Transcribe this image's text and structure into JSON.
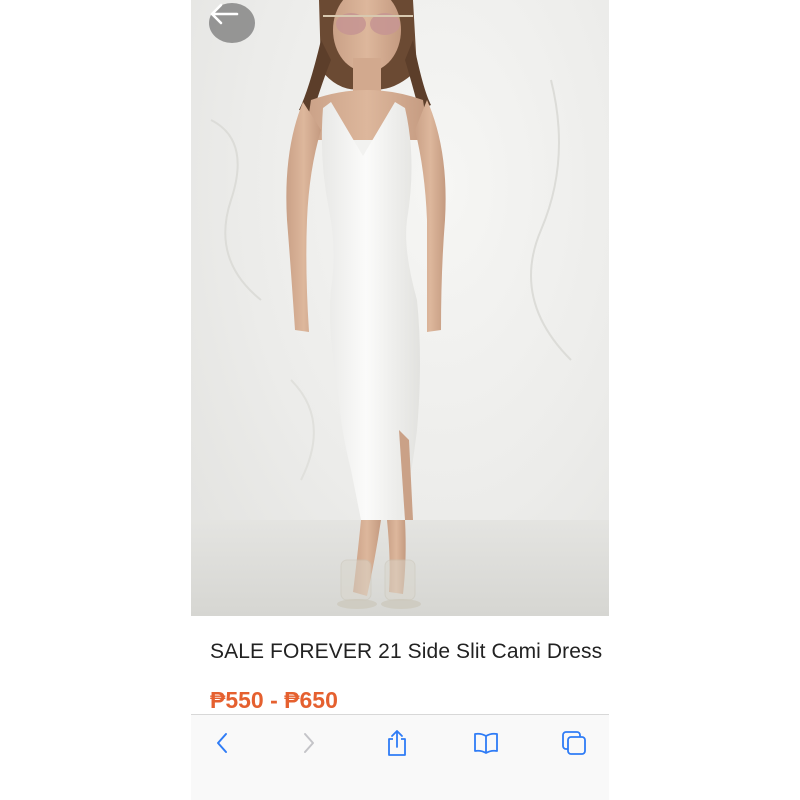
{
  "product": {
    "title": "SALE FOREVER 21 Side Slit Cami Dress",
    "price_range": "₱550 - ₱650"
  },
  "colors": {
    "price": "#e5602f",
    "toolbar_icon": "#2f7cf6",
    "toolbar_icon_disabled": "#c4c4c8"
  },
  "toolbar": {
    "items": [
      {
        "icon": "chevron-left-icon",
        "enabled": true
      },
      {
        "icon": "chevron-right-icon",
        "enabled": false
      },
      {
        "icon": "share-icon",
        "enabled": true
      },
      {
        "icon": "book-icon",
        "enabled": true
      },
      {
        "icon": "tabs-icon",
        "enabled": true
      }
    ]
  }
}
